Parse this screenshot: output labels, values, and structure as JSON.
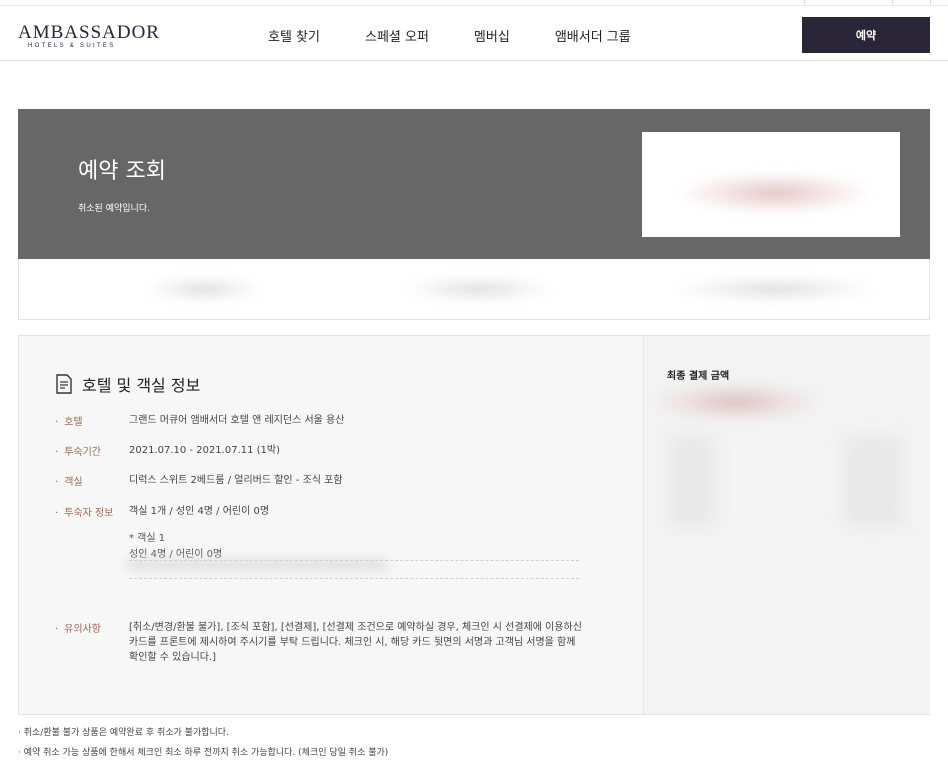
{
  "header": {
    "logo_main": "AMBASSADOR",
    "logo_sub": "HOTELS & SUITES",
    "nav": [
      "호텔 찾기",
      "스페셜 오퍼",
      "멤버십",
      "앰배서더 그룹"
    ],
    "reserve_label": "예약"
  },
  "hero": {
    "title": "예약 조회",
    "subtitle": "취소된 예약입니다."
  },
  "section": {
    "title": "호텔 및 객실 정보",
    "rows": [
      {
        "label": "호텔",
        "value": "그랜드 머큐어 앰배서더 호텔 앤 레지던스 서울 용산"
      },
      {
        "label": "투숙기간",
        "value": "2021.07.10 - 2021.07.11 (1박)"
      },
      {
        "label": "객실",
        "value": "디럭스 스위트 2베드룸 / 얼리버드 할인 - 조식 포함"
      },
      {
        "label": "투숙자 정보",
        "value": "객실 1개 / 성인 4명 / 어린이 0명"
      }
    ],
    "room_detail_title": "* 객실 1",
    "room_detail_value": "성인 4명 / 어린이 0명",
    "notice_label": "유의사항",
    "notice_text": "[취소/변경/환불 불가], [조식 포함], [선결제], [선결제 조건으로 예약하실 경우, 체크인 시 선결제에 이용하신 카드를 프론트에 제시하여 주시기를 부탁 드립니다. 체크인 시, 해당 카드 뒷면의 서명과 고객님 서명을 함께 확인할 수 있습니다.]"
  },
  "payment": {
    "total_label": "최종 결제 금액"
  },
  "footnotes": [
    "· 취소/환불 불가 상품은 예약완료 후 취소가 불가합니다.",
    "· 예약 취소 가능 상품에 한해서 체크인 최소 하루 전까지 취소 가능합니다. (체크인 당일 취소 불가)"
  ],
  "colors": {
    "brand_navy": "#2a2638",
    "hero_gray": "#676767",
    "label_brown": "#9b6a52"
  }
}
